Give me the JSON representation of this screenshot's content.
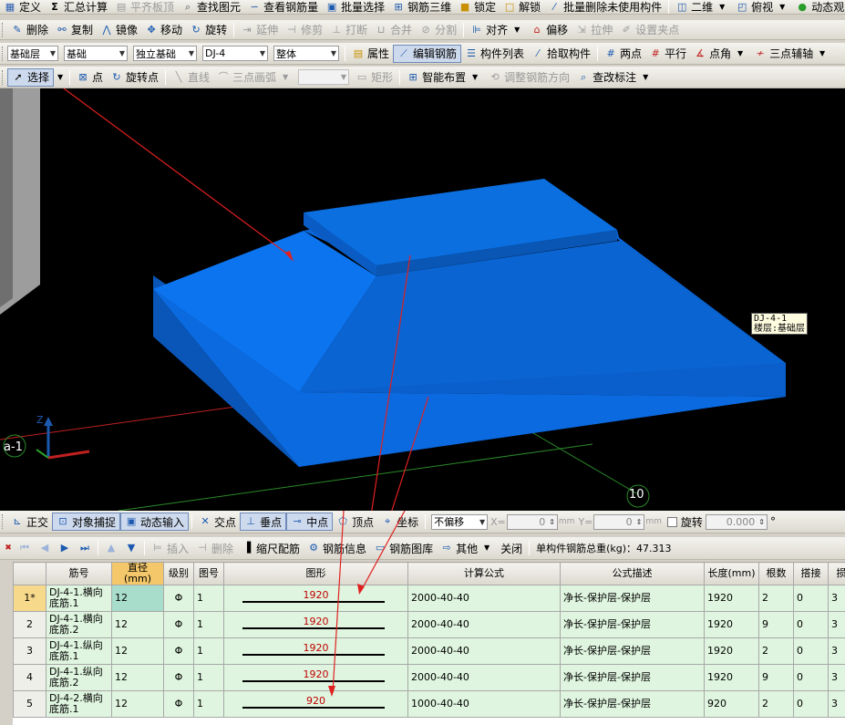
{
  "menubar": {
    "items": [
      "定义",
      "汇总计算",
      "平齐板顶",
      "查找图元",
      "查看钢筋量",
      "批量选择",
      "钢筋三维",
      "锁定",
      "解锁",
      "批量删除未使用构件",
      "二维",
      "俯视",
      "动态观"
    ]
  },
  "edit_toolbar": {
    "items": [
      "删除",
      "复制",
      "镜像",
      "移动",
      "旋转",
      "延伸",
      "修剪",
      "打断",
      "合并",
      "分割",
      "对齐",
      "偏移",
      "拉伸",
      "设置夹点"
    ]
  },
  "component_toolbar": {
    "floor": "基础层",
    "category": "基础",
    "type": "独立基础",
    "name": "DJ-4",
    "mode": "整体",
    "properties": "属性",
    "edit_rebar": "编辑钢筋",
    "component_list": "构件列表",
    "pick_component": "拾取构件",
    "two_points": "两点",
    "parallel": "平行",
    "point_angle": "点角",
    "three_point_axis": "三点辅轴"
  },
  "draw_toolbar": {
    "select": "选择",
    "point": "点",
    "rotate_point": "旋转点",
    "line": "直线",
    "three_point_arc": "三点画弧",
    "rect": "矩形",
    "smart_layout": "智能布置",
    "adjust_direction": "调整钢筋方向",
    "check_annotation": "查改标注"
  },
  "viewport": {
    "tag_line1": "DJ-4-1",
    "tag_line2": "楼层:基础层",
    "axis_a1": "a-1",
    "axis_10": "10",
    "axis_z": "Z"
  },
  "snap_bar": {
    "ortho": "正交",
    "object_snap": "对象捕捉",
    "dynamic_input": "动态输入",
    "intersection": "交点",
    "perpendicular": "垂点",
    "midpoint": "中点",
    "vertex": "顶点",
    "coordinate": "坐标",
    "offset_mode": "不偏移",
    "x_label": "X=",
    "x_value": "0",
    "y_label": "Y=",
    "y_value": "0",
    "unit": "mm",
    "rotate_label": "旋转",
    "rotate_value": "0.000",
    "degree": "°"
  },
  "grid_toolbar": {
    "insert": "插入",
    "delete": "删除",
    "scale_rebar": "缩尺配筋",
    "rebar_info": "钢筋信息",
    "rebar_library": "钢筋图库",
    "other": "其他",
    "close": "关闭",
    "total_label": "单构件钢筋总重(kg)：47.313"
  },
  "table": {
    "headers": [
      "",
      "筋号",
      "直径(mm)",
      "级别",
      "图号",
      "图形",
      "计算公式",
      "公式描述",
      "长度(mm)",
      "根数",
      "搭接",
      "损耗"
    ],
    "rows": [
      {
        "num": "1*",
        "name": "DJ-4-1.横向底筋.1",
        "dia": "12",
        "grade": "Φ",
        "fig": "1",
        "shape": "1920",
        "formula": "2000-40-40",
        "desc": "净长-保护层-保护层",
        "length": "1920",
        "count": "2",
        "lap": "0",
        "loss": "3"
      },
      {
        "num": "2",
        "name": "DJ-4-1.横向底筋.2",
        "dia": "12",
        "grade": "Φ",
        "fig": "1",
        "shape": "1920",
        "formula": "2000-40-40",
        "desc": "净长-保护层-保护层",
        "length": "1920",
        "count": "9",
        "lap": "0",
        "loss": "3"
      },
      {
        "num": "3",
        "name": "DJ-4-1.纵向底筋.1",
        "dia": "12",
        "grade": "Φ",
        "fig": "1",
        "shape": "1920",
        "formula": "2000-40-40",
        "desc": "净长-保护层-保护层",
        "length": "1920",
        "count": "2",
        "lap": "0",
        "loss": "3"
      },
      {
        "num": "4",
        "name": "DJ-4-1.纵向底筋.2",
        "dia": "12",
        "grade": "Φ",
        "fig": "1",
        "shape": "1920",
        "formula": "2000-40-40",
        "desc": "净长-保护层-保护层",
        "length": "1920",
        "count": "9",
        "lap": "0",
        "loss": "3"
      },
      {
        "num": "5",
        "name": "DJ-4-2.横向底筋.1",
        "dia": "12",
        "grade": "Φ",
        "fig": "1",
        "shape": "920",
        "formula": "1000-40-40",
        "desc": "净长-保护层-保护层",
        "length": "920",
        "count": "2",
        "lap": "0",
        "loss": "3"
      }
    ]
  },
  "colors": {
    "foundation": "#0b6fe0",
    "foundation_dark": "#0a56b8",
    "annotation_arrow": "#e02020",
    "row_bg": "#dff5df",
    "header_highlight": "#f3c76a"
  }
}
